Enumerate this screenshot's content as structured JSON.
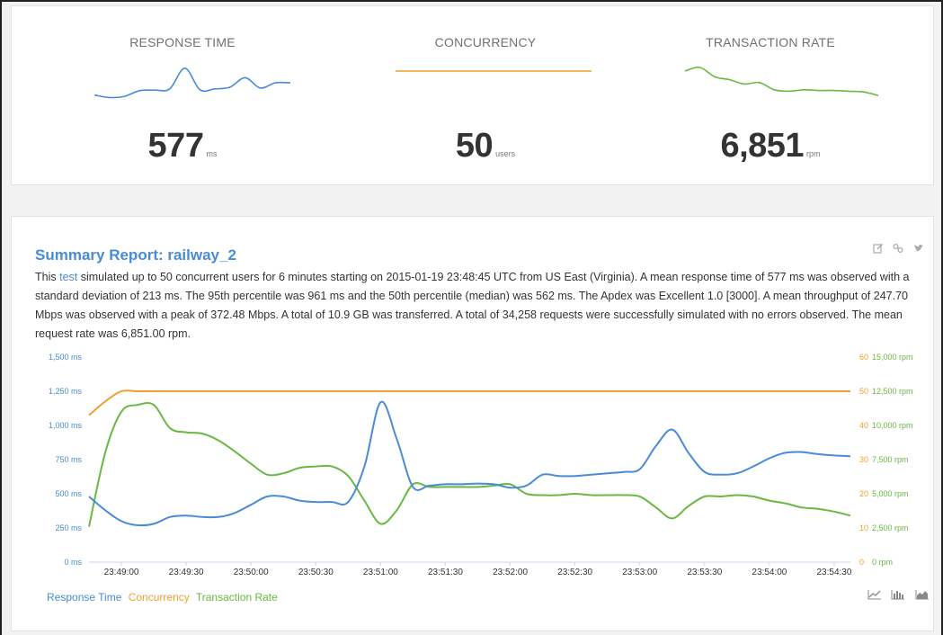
{
  "metrics": [
    {
      "title": "RESPONSE TIME",
      "value": "577",
      "unit": "ms",
      "color": "#4a8bd6",
      "spark": [
        470,
        455,
        462,
        495,
        498,
        505,
        625,
        500,
        505,
        515,
        570,
        510,
        540,
        540
      ]
    },
    {
      "title": "CONCURRENCY",
      "value": "50",
      "unit": "users",
      "color": "#f0a030",
      "spark": [
        50,
        50,
        50,
        50,
        50,
        50,
        50,
        50,
        50,
        50,
        50,
        50,
        50,
        50
      ]
    },
    {
      "title": "TRANSACTION RATE",
      "value": "6,851",
      "unit": "rpm",
      "color": "#6ab842",
      "spark": [
        11000,
        11500,
        10200,
        9800,
        9200,
        9400,
        8400,
        8200,
        8400,
        8300,
        8300,
        8200,
        8100,
        7600
      ]
    }
  ],
  "report": {
    "title": "Summary Report: railway_2",
    "text_before_link": "This ",
    "link": "test",
    "text_after_link": " simulated up to 50 concurrent users for 6 minutes starting on 2015-01-19 23:48:45 UTC from US East (Virginia). A mean response time of 577 ms was observed with a standard deviation of 213 ms. The 95th percentile was 961 ms and the 50th percentile (median) was 562 ms. The Apdex was Excellent 1.0 [3000]. A mean throughput of 247.70 Mbps was observed with a peak of 372.48 Mbps. A total of 10.9 GB was transferred. A total of 34,258 requests were successfully simulated with no errors observed. The mean request rate was 6,851.00 rpm.",
    "icons": [
      "edit-icon",
      "link-icon",
      "twitter-icon"
    ]
  },
  "chart_data": {
    "type": "line",
    "x": [
      "23:48:45",
      "23:48:52",
      "23:49:00",
      "23:49:07",
      "23:49:15",
      "23:49:22",
      "23:49:30",
      "23:49:37",
      "23:49:45",
      "23:49:52",
      "23:50:00",
      "23:50:07",
      "23:50:15",
      "23:50:22",
      "23:50:30",
      "23:50:37",
      "23:50:45",
      "23:50:52",
      "23:51:00",
      "23:51:07",
      "23:51:15",
      "23:51:22",
      "23:51:30",
      "23:51:37",
      "23:51:45",
      "23:51:52",
      "23:52:00",
      "23:52:07",
      "23:52:15",
      "23:52:22",
      "23:52:30",
      "23:52:37",
      "23:52:45",
      "23:52:52",
      "23:53:00",
      "23:53:07",
      "23:53:15",
      "23:53:22",
      "23:53:30",
      "23:53:37",
      "23:53:45",
      "23:53:52",
      "23:54:00",
      "23:54:07",
      "23:54:15",
      "23:54:22",
      "23:54:30",
      "23:54:37"
    ],
    "x_ticks": [
      "23:49:00",
      "23:49:30",
      "23:50:00",
      "23:50:30",
      "23:51:00",
      "23:51:30",
      "23:52:00",
      "23:52:30",
      "23:53:00",
      "23:53:30",
      "23:54:00",
      "23:54:30"
    ],
    "series": [
      {
        "name": "Response Time",
        "axis": "left",
        "color": "#4a8bd6",
        "values": [
          480,
          380,
          300,
          270,
          280,
          330,
          340,
          330,
          330,
          360,
          420,
          480,
          480,
          450,
          440,
          440,
          440,
          700,
          1170,
          900,
          550,
          560,
          570,
          570,
          575,
          570,
          545,
          560,
          640,
          630,
          630,
          640,
          650,
          660,
          680,
          850,
          970,
          800,
          660,
          640,
          650,
          700,
          760,
          800,
          805,
          790,
          780,
          775
        ]
      },
      {
        "name": "Concurrency",
        "axis": "right",
        "color": "#f0a030",
        "values": [
          43,
          47,
          50,
          50,
          50,
          50,
          50,
          50,
          50,
          50,
          50,
          50,
          50,
          50,
          50,
          50,
          50,
          50,
          50,
          50,
          50,
          50,
          50,
          50,
          50,
          50,
          50,
          50,
          50,
          50,
          50,
          50,
          50,
          50,
          50,
          50,
          50,
          50,
          50,
          50,
          50,
          50,
          50,
          50,
          50,
          50,
          50,
          50
        ]
      },
      {
        "name": "Transaction Rate",
        "axis": "right2",
        "color": "#6ab842",
        "values": [
          2600,
          8000,
          11000,
          11500,
          11500,
          9800,
          9500,
          9400,
          8900,
          8100,
          7200,
          6400,
          6500,
          6900,
          7000,
          7000,
          6300,
          4500,
          2800,
          3800,
          5700,
          5500,
          5500,
          5500,
          5500,
          5600,
          5700,
          5000,
          4900,
          4900,
          5000,
          4900,
          4900,
          4900,
          4800,
          4000,
          3200,
          4100,
          4800,
          4800,
          4900,
          4800,
          4500,
          4300,
          4000,
          3900,
          3700,
          3400
        ]
      }
    ],
    "y_left": {
      "ticks": [
        "0 ms",
        "250 ms",
        "500 ms",
        "750 ms",
        "1,000 ms",
        "1,250 ms",
        "1,500 ms"
      ],
      "range": [
        0,
        1500
      ]
    },
    "y_right": {
      "ticks": [
        "0",
        "10",
        "20",
        "30",
        "40",
        "50",
        "60"
      ],
      "range": [
        0,
        60
      ]
    },
    "y_right2": {
      "ticks": [
        "0 rpm",
        "2,500 rpm",
        "5,000 rpm",
        "7,500 rpm",
        "10,000 rpm",
        "12,500 rpm",
        "15,000 rpm"
      ],
      "range": [
        0,
        15000
      ]
    }
  },
  "legend": [
    {
      "label": "Response Time",
      "color": "#4a8bd6"
    },
    {
      "label": "Concurrency",
      "color": "#f0a030"
    },
    {
      "label": "Transaction Rate",
      "color": "#6ab842"
    }
  ],
  "chart_type_icons": [
    "line-chart-icon",
    "bar-chart-icon",
    "area-chart-icon"
  ]
}
